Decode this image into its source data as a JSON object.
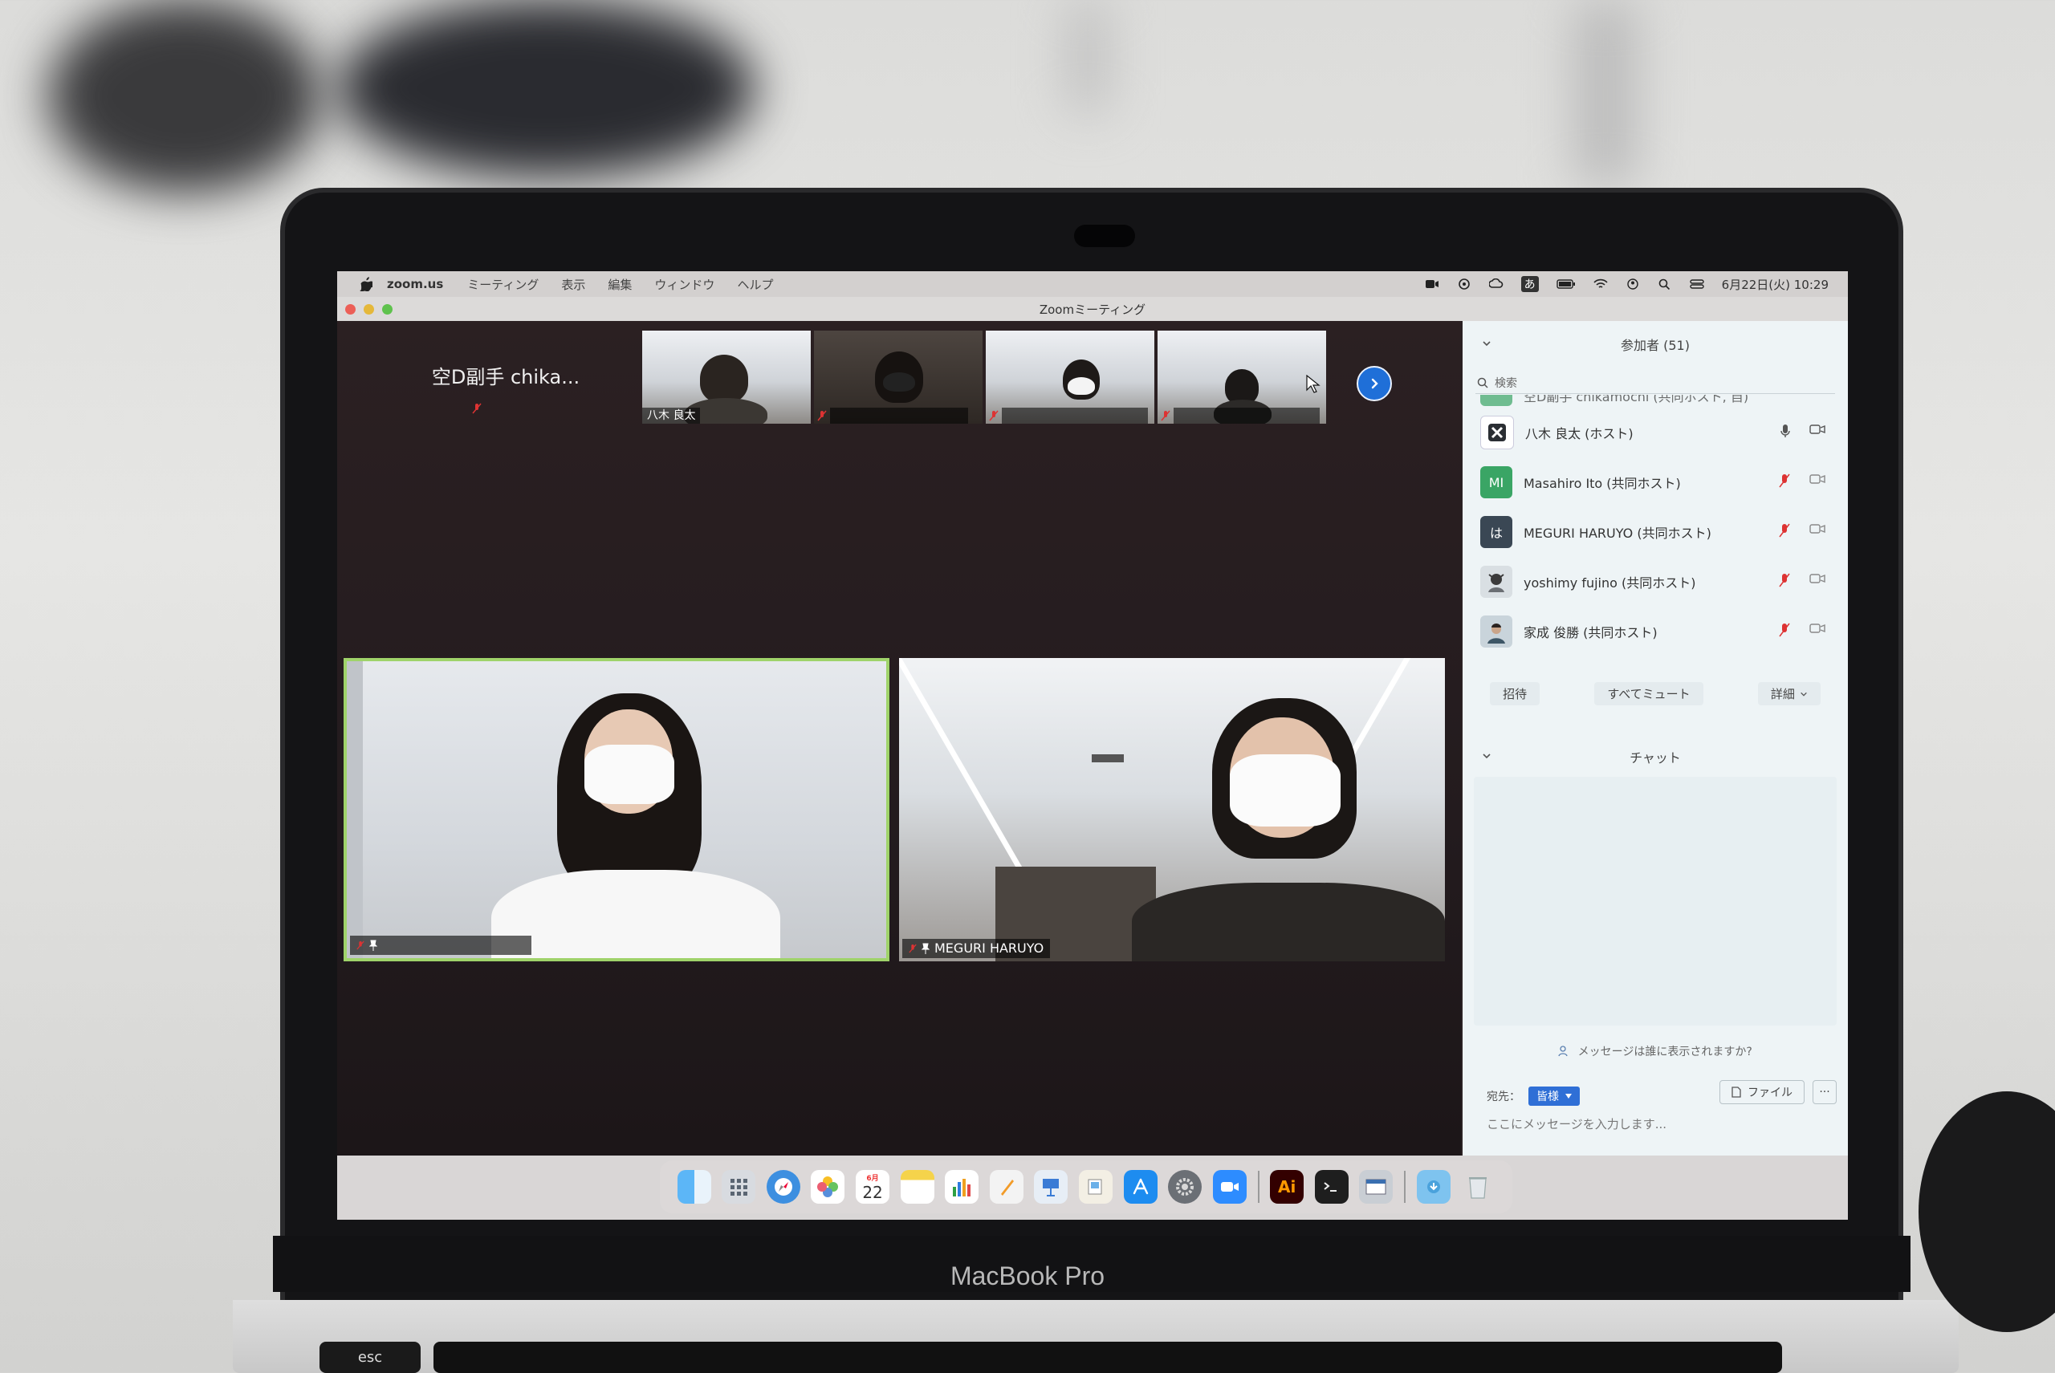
{
  "menubar": {
    "app_name": "zoom.us",
    "menus": [
      "ミーティング",
      "表示",
      "編集",
      "ウィンドウ",
      "ヘルプ"
    ],
    "clock": "6月22日(火) 10:29",
    "input_indicator": "あ"
  },
  "window": {
    "title": "Zoomミーティング"
  },
  "gallery_strip": {
    "name_only_tile": "空D副手 chika...",
    "thumbnails": [
      {
        "label": "八木 良太"
      },
      {
        "label": ""
      },
      {
        "label": ""
      },
      {
        "label": ""
      }
    ]
  },
  "main_tiles": [
    {
      "label": "",
      "active": true
    },
    {
      "label": "MEGURI HARUYO",
      "active": false
    }
  ],
  "participants_panel": {
    "header": "参加者 (51)",
    "search_placeholder": "検索",
    "partial_row": "空D副手 chikamochi (共同ホスト, 自)",
    "rows": [
      {
        "name": "八木 良太 (ホスト)",
        "avatar_text": "",
        "avatar_color": "#3b3f45"
      },
      {
        "name": "Masahiro Ito (共同ホスト)",
        "avatar_text": "MI",
        "avatar_color": "#3aa565"
      },
      {
        "name": "MEGURI HARUYO (共同ホスト)",
        "avatar_text": "は",
        "avatar_color": "#3a4754"
      },
      {
        "name": "yoshimy fujino (共同ホスト)",
        "avatar_text": "",
        "avatar_color": "#6a6e73"
      },
      {
        "name": "家成 俊勝 (共同ホスト)",
        "avatar_text": "",
        "avatar_color": "#8a9aa6"
      }
    ],
    "buttons": {
      "invite": "招待",
      "mute_all": "すべてミュート",
      "more": "詳細"
    }
  },
  "chat": {
    "header": "チャット",
    "visibility_hint": "メッセージは誰に表示されますか?",
    "to_label": "宛先：",
    "to_value": "皆様",
    "file_button": "ファイル",
    "more_button": "···",
    "input_placeholder": "ここにメッセージを入力します..."
  },
  "dock": {
    "calendar_month": "6月",
    "calendar_day": "22",
    "ai_label": "Ai"
  },
  "hardware": {
    "brand": "MacBook Pro",
    "esc": "esc"
  }
}
